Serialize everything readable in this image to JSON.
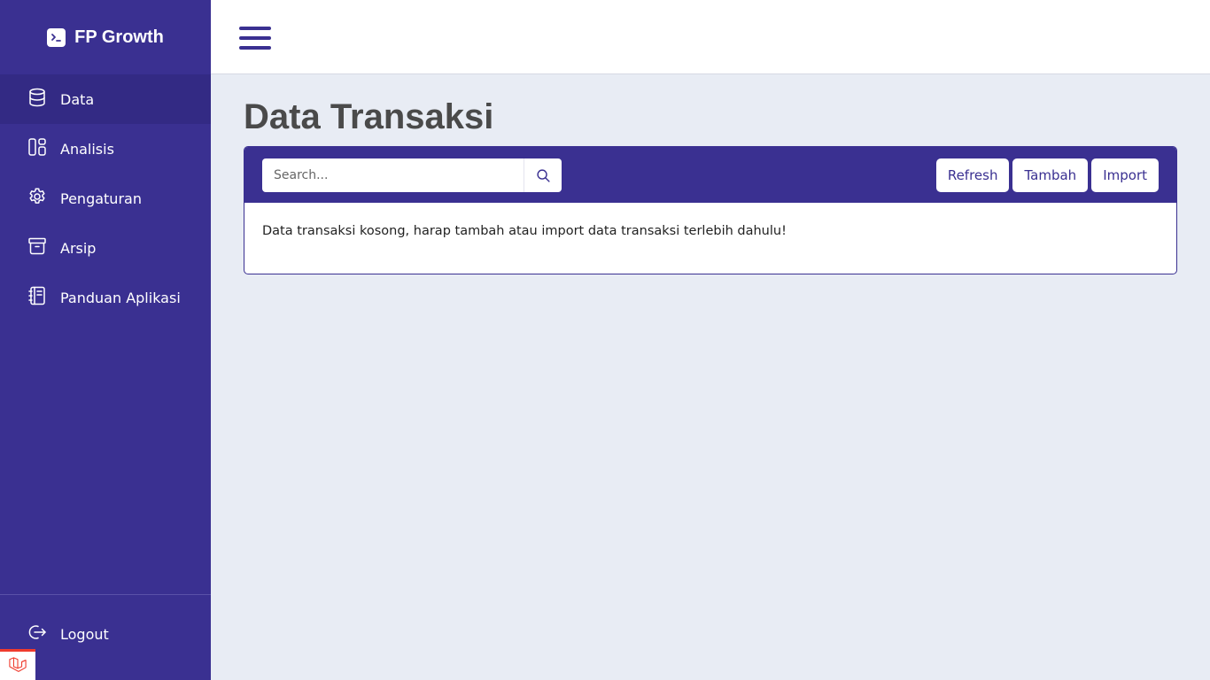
{
  "app": {
    "title": "FP Growth",
    "brand_icon": "terminal-icon"
  },
  "sidebar": {
    "items": [
      {
        "label": "Data",
        "icon": "database-icon",
        "active": true
      },
      {
        "label": "Analisis",
        "icon": "layout-icon",
        "active": false
      },
      {
        "label": "Pengaturan",
        "icon": "gear-icon",
        "active": false
      },
      {
        "label": "Arsip",
        "icon": "archive-icon",
        "active": false
      },
      {
        "label": "Panduan Aplikasi",
        "icon": "book-icon",
        "active": false
      }
    ],
    "logout_label": "Logout"
  },
  "page": {
    "title": "Data Transaksi"
  },
  "toolbar": {
    "search_placeholder": "Search...",
    "search_value": "",
    "refresh_label": "Refresh",
    "add_label": "Tambah",
    "import_label": "Import"
  },
  "main": {
    "empty_message": "Data transaksi kosong, harap tambah atau import data transaksi terlebih dahulu!"
  },
  "colors": {
    "primary": "#3a3091",
    "active_nav": "#332a84",
    "background": "#e8ecf4",
    "title_text": "#4a4a4a"
  }
}
